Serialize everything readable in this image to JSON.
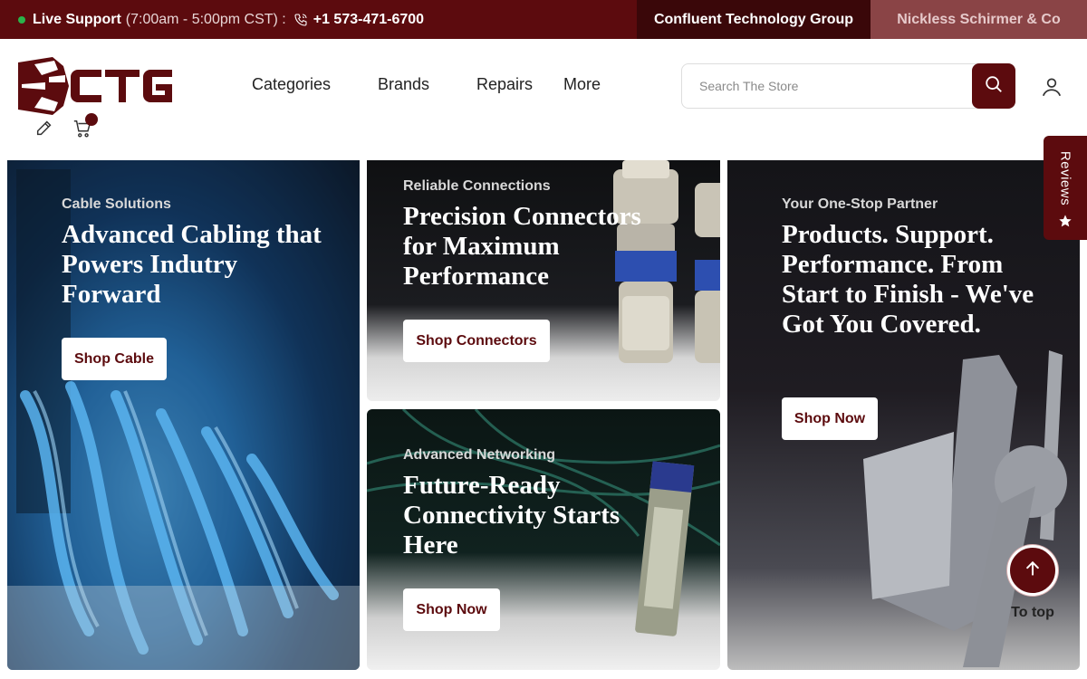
{
  "topbar": {
    "live_label": "Live Support",
    "hours": "(7:00am - 5:00pm CST) :",
    "phone": "+1 573-471-6700",
    "tabs": [
      {
        "label": "Confluent Technology Group"
      },
      {
        "label": "Nickless Schirmer & Co"
      }
    ]
  },
  "header": {
    "logo_text": "CTG",
    "nav": [
      {
        "label": "Categories"
      },
      {
        "label": "Brands"
      },
      {
        "label": "Repairs"
      },
      {
        "label": "More"
      }
    ],
    "search_placeholder": "Search The Store",
    "icons": [
      "phone-icon",
      "search-icon",
      "user-icon",
      "edit-icon",
      "cart-icon"
    ]
  },
  "banners": [
    {
      "eyebrow": "Cable Solutions",
      "headline": "Advanced Cabling that Powers Indutry Forward",
      "button": "Shop Cable"
    },
    {
      "eyebrow": "Reliable Connections",
      "headline": "Precision Connectors for Maximum Performance",
      "button": "Shop Connectors"
    },
    {
      "eyebrow": "Advanced Networking",
      "headline": "Future-Ready Connectivity Starts Here",
      "button": "Shop Now"
    },
    {
      "eyebrow": "Your One-Stop Partner",
      "headline": "Products. Support. Performance. From Start to Finish - We've Got You Covered.",
      "button": "Shop Now"
    }
  ],
  "widgets": {
    "reviews_label": "Reviews",
    "to_top_label": "To top"
  },
  "colors": {
    "brand": "#5c0b0e",
    "brand_dark": "#3a0709",
    "brand_muted": "#8a4446",
    "online": "#2bb34a"
  }
}
